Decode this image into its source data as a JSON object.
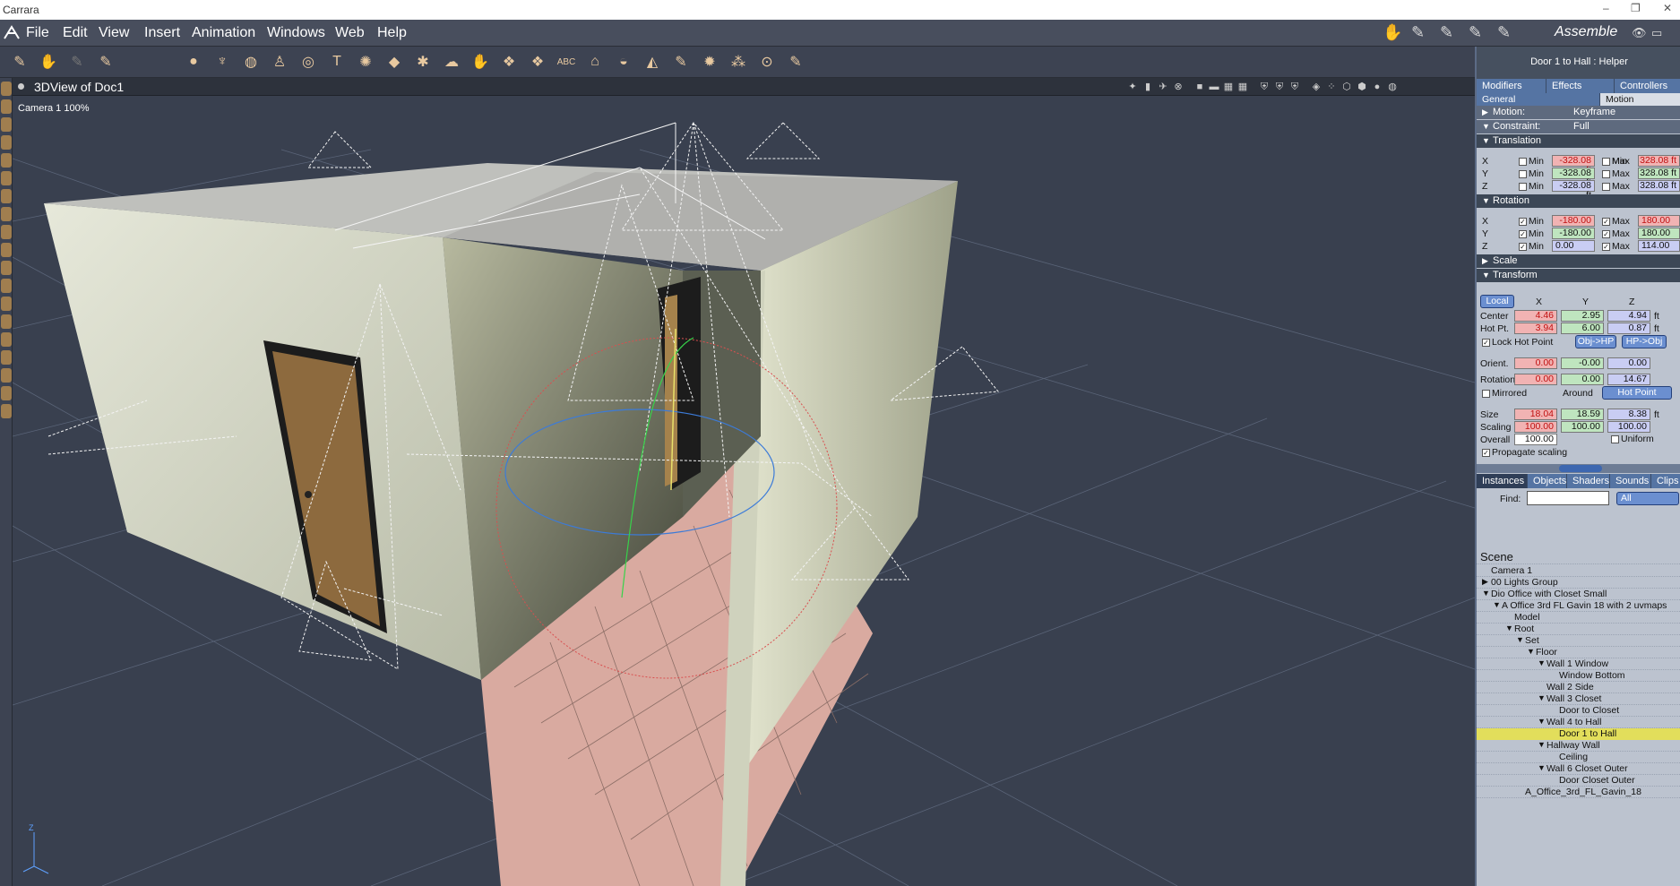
{
  "window": {
    "title": "Carrara",
    "controls": [
      "–",
      "❐",
      "✕"
    ]
  },
  "menu": [
    "File",
    "Edit",
    "View",
    "Insert",
    "Animation",
    "Windows",
    "Web",
    "Help"
  ],
  "room": {
    "label": "Assemble"
  },
  "viewport": {
    "title": "3DView of Doc1",
    "camera_label": "Camera 1 100%"
  },
  "panel": {
    "title": "Door 1 to Hall : Helper",
    "tabs1": [
      "Modifiers",
      "Effects",
      "Controllers"
    ],
    "tabs2": [
      "General",
      "Motion"
    ],
    "motion": {
      "label": "Motion:",
      "value": "Keyframe"
    },
    "constraint": {
      "label": "Constraint:",
      "value": "Full"
    },
    "translation": {
      "title": "Translation",
      "min_label": "Min",
      "max_label": "Max",
      "rows": [
        {
          "axis": "X",
          "min": "-328.08 ft",
          "max": "328.08 ft"
        },
        {
          "axis": "Y",
          "min": "-328.08 ft",
          "max": "328.08 ft"
        },
        {
          "axis": "Z",
          "min": "-328.08 ft",
          "max": "328.08 ft"
        }
      ]
    },
    "rotation": {
      "title": "Rotation",
      "rows": [
        {
          "axis": "X",
          "min": "-180.00",
          "max": "180.00"
        },
        {
          "axis": "Y",
          "min": "-180.00",
          "max": "180.00"
        },
        {
          "axis": "Z",
          "min": "0.00",
          "max": "114.00"
        }
      ]
    },
    "scale": {
      "title": "Scale"
    },
    "transform": {
      "title": "Transform",
      "space": "Local",
      "cols": [
        "X",
        "Y",
        "Z"
      ],
      "center": {
        "label": "Center",
        "x": "4.46",
        "y": "2.95",
        "z": "4.94",
        "unit": "ft"
      },
      "hotpt": {
        "label": "Hot Pt.",
        "x": "3.94",
        "y": "6.00",
        "z": "0.87",
        "unit": "ft"
      },
      "lock_hot_point": "Lock Hot Point",
      "obj_hp": "Obj->HP",
      "hp_obj": "HP->Obj",
      "orient": {
        "label": "Orient.",
        "x": "0.00",
        "y": "-0.00",
        "z": "0.00"
      },
      "rotation": {
        "label": "Rotation",
        "x": "0.00",
        "y": "0.00",
        "z": "14.67"
      },
      "mirrored": "Mirrored",
      "around_label": "Around",
      "around_value": "Hot Point",
      "size": {
        "label": "Size",
        "x": "18.04",
        "y": "18.59",
        "z": "8.38",
        "unit": "ft"
      },
      "scaling": {
        "label": "Scaling",
        "x": "100.00",
        "y": "100.00",
        "z": "100.00"
      },
      "overall": {
        "label": "Overall",
        "value": "100.00"
      },
      "uniform": "Uniform",
      "propagate": "Propagate scaling"
    },
    "tabs3": [
      "Instances",
      "Objects",
      "Shaders",
      "Sounds",
      "Clips"
    ],
    "find": {
      "label": "Find:",
      "value": "",
      "filter": "All"
    },
    "tree": [
      {
        "label": "Scene"
      },
      {
        "label": "Camera 1"
      },
      {
        "label": "00 Lights Group"
      },
      {
        "label": "Dio Office with Closet Small"
      },
      {
        "label": "A Office 3rd FL Gavin 18 with 2 uvmaps"
      },
      {
        "label": "Model"
      },
      {
        "label": "Root"
      },
      {
        "label": "Set"
      },
      {
        "label": "Floor"
      },
      {
        "label": "Wall 1 Window"
      },
      {
        "label": "Window Bottom"
      },
      {
        "label": "Wall 2 Side"
      },
      {
        "label": "Wall 3 Closet"
      },
      {
        "label": "Door to Closet"
      },
      {
        "label": "Wall 4 to Hall"
      },
      {
        "label": "Door 1 to Hall"
      },
      {
        "label": "Hallway Wall"
      },
      {
        "label": "Ceiling"
      },
      {
        "label": "Wall 6 Closet Outer"
      },
      {
        "label": "Door Closet Outer"
      },
      {
        "label": "A_Office_3rd_FL_Gavin_18"
      }
    ]
  }
}
